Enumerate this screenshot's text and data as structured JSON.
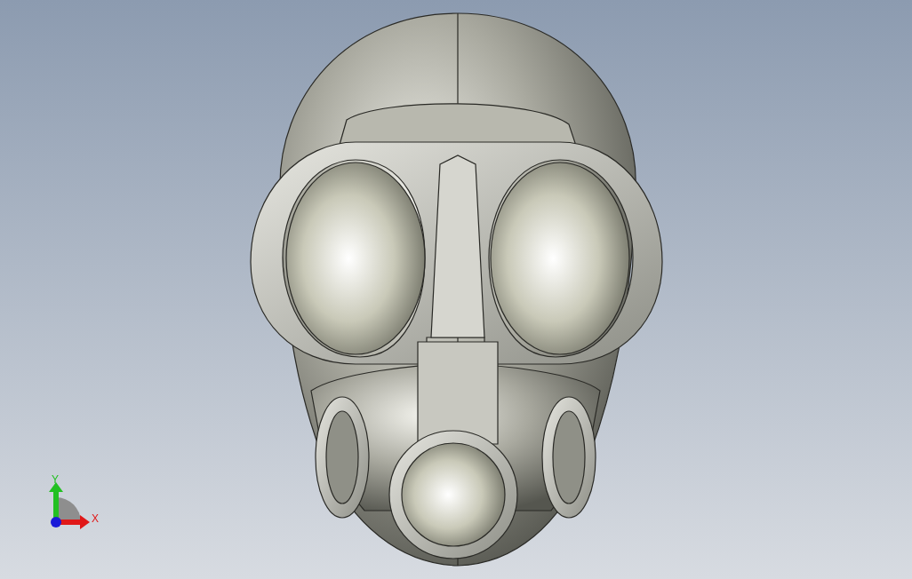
{
  "viewport": {
    "triad": {
      "axes": [
        {
          "kind": "vertical",
          "label": "Y",
          "color": "#22c022"
        },
        {
          "kind": "horizontal",
          "label": "X",
          "color": "#e01818"
        }
      ]
    }
  }
}
